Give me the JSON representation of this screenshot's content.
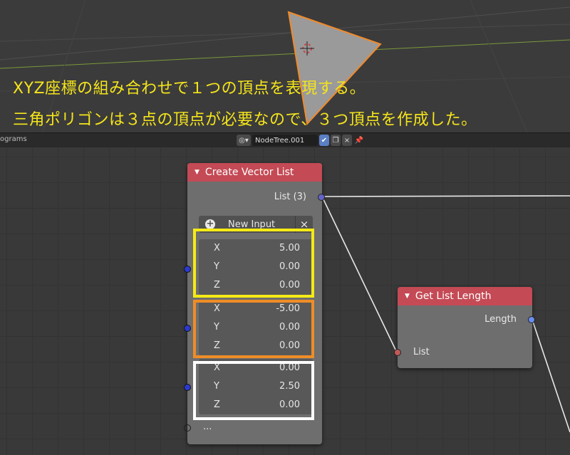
{
  "viewport": {
    "caption_line1": "XYZ座標の組み合わせで１つの頂点を表現する。",
    "caption_line2": "三角ポリゴンは３点の頂点が必要なので、３つ頂点を作成した。",
    "caption_color": "#f5e51a",
    "triangle_fill": "#9a9a9a",
    "triangle_outline": "#f08a2a"
  },
  "header": {
    "editor_name": "ograms",
    "tree_name": "NodeTree.001",
    "unlink_icon": "×"
  },
  "nodes": {
    "create_vector_list": {
      "title": "Create Vector List",
      "output_label": "List (3)",
      "new_input_label": "New Input",
      "remove_icon": "×",
      "vectors": [
        {
          "x_label": "X",
          "x": "5.00",
          "y_label": "Y",
          "y": "0.00",
          "z_label": "Z",
          "z": "0.00"
        },
        {
          "x_label": "X",
          "x": "-5.00",
          "y_label": "Y",
          "y": "0.00",
          "z_label": "Z",
          "z": "0.00"
        },
        {
          "x_label": "X",
          "x": "0.00",
          "y_label": "Y",
          "y": "2.50",
          "z_label": "Z",
          "z": "0.00"
        }
      ],
      "extra_socket_label": "..."
    },
    "get_list_length": {
      "title": "Get List Length",
      "output_label": "Length",
      "input_label": "List"
    }
  },
  "colors": {
    "node_header": "#c44a55",
    "highlight_1": "#f5ea14",
    "highlight_2": "#ee8d27",
    "highlight_3": "#ffffff"
  }
}
